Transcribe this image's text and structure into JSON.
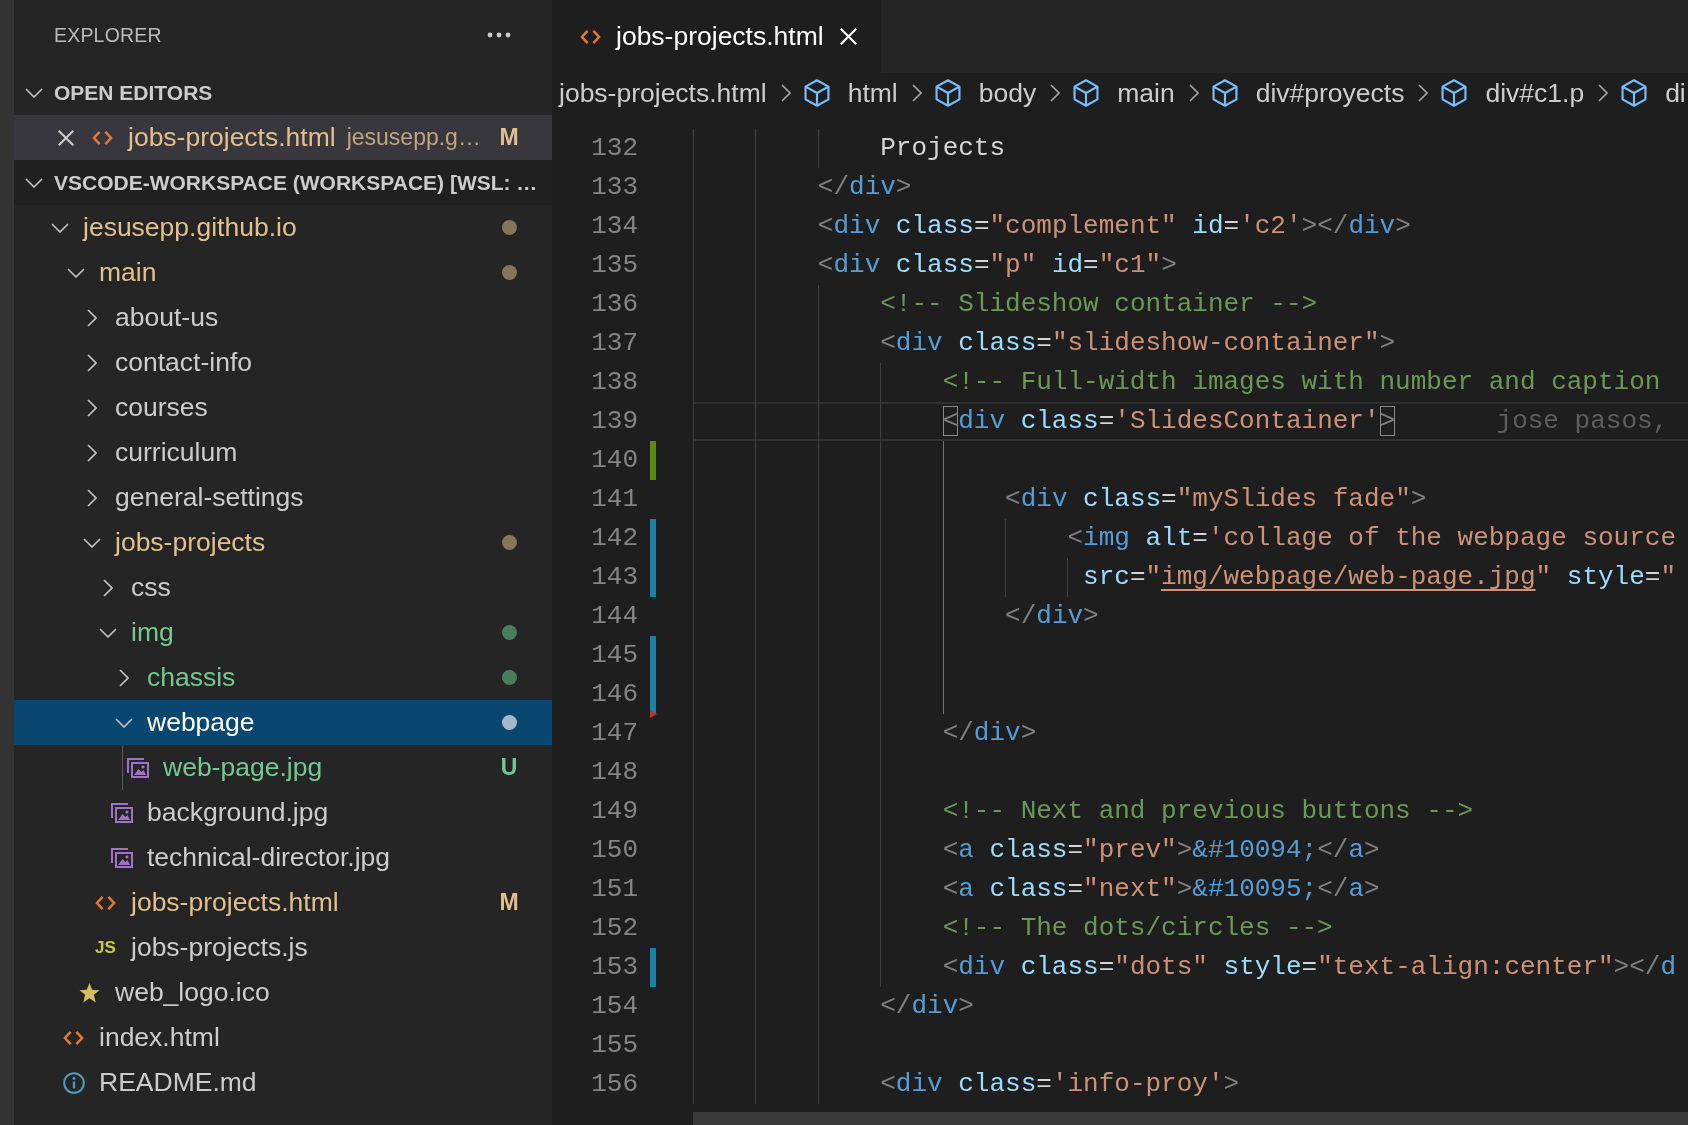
{
  "sidebar": {
    "title": "EXPLORER",
    "open_editors": {
      "title": "OPEN EDITORS",
      "expanded": true,
      "items": [
        {
          "name": "jobs-projects.html",
          "description": "jesusepp.g…",
          "kind": "html",
          "modified": true,
          "untracked": false,
          "badge": "M",
          "selected": true
        }
      ]
    },
    "workspace": {
      "title": "VSCODE-WORKSPACE (WORKSPACE) [WSL: …",
      "expanded": true,
      "tree": [
        {
          "name": "jesusepp.github.io",
          "kind": "folder",
          "modified": true,
          "untracked": false,
          "expanded": true,
          "selected": false,
          "children": [
            {
              "name": "main",
              "kind": "folder",
              "modified": true,
              "untracked": false,
              "expanded": true,
              "selected": false,
              "children": [
                {
                  "name": "about-us",
                  "kind": "folder",
                  "modified": false,
                  "untracked": false,
                  "expanded": false,
                  "selected": false
                },
                {
                  "name": "contact-info",
                  "kind": "folder",
                  "modified": false,
                  "untracked": false,
                  "expanded": false,
                  "selected": false
                },
                {
                  "name": "courses",
                  "kind": "folder",
                  "modified": false,
                  "untracked": false,
                  "expanded": false,
                  "selected": false
                },
                {
                  "name": "curriculum",
                  "kind": "folder",
                  "modified": false,
                  "untracked": false,
                  "expanded": false,
                  "selected": false
                },
                {
                  "name": "general-settings",
                  "kind": "folder",
                  "modified": false,
                  "untracked": false,
                  "expanded": false,
                  "selected": false
                },
                {
                  "name": "jobs-projects",
                  "kind": "folder",
                  "modified": true,
                  "untracked": false,
                  "expanded": true,
                  "selected": false,
                  "children": [
                    {
                      "name": "css",
                      "kind": "folder",
                      "modified": false,
                      "untracked": false,
                      "expanded": false,
                      "selected": false
                    },
                    {
                      "name": "img",
                      "kind": "folder",
                      "modified": false,
                      "untracked": true,
                      "expanded": true,
                      "selected": false,
                      "children": [
                        {
                          "name": "chassis",
                          "kind": "folder",
                          "modified": false,
                          "untracked": true,
                          "expanded": false,
                          "selected": false
                        },
                        {
                          "name": "webpage",
                          "kind": "folder",
                          "modified": false,
                          "untracked": true,
                          "expanded": true,
                          "selected": true,
                          "children": [
                            {
                              "name": "web-page.jpg",
                              "kind": "image",
                              "modified": false,
                              "untracked": true,
                              "badge": "U",
                              "selected": false
                            }
                          ]
                        },
                        {
                          "name": "background.jpg",
                          "kind": "image",
                          "modified": false,
                          "untracked": false,
                          "selected": false
                        },
                        {
                          "name": "technical-director.jpg",
                          "kind": "image",
                          "modified": false,
                          "untracked": false,
                          "selected": false
                        }
                      ]
                    },
                    {
                      "name": "jobs-projects.html",
                      "kind": "html",
                      "modified": true,
                      "untracked": false,
                      "badge": "M",
                      "selected": false
                    },
                    {
                      "name": "jobs-projects.js",
                      "kind": "script",
                      "modified": false,
                      "untracked": false,
                      "icon_text": "JS",
                      "selected": false
                    }
                  ]
                },
                {
                  "name": "web_logo.ico",
                  "kind": "favicon",
                  "modified": false,
                  "untracked": false,
                  "selected": false
                }
              ]
            },
            {
              "name": "index.html",
              "kind": "html",
              "modified": false,
              "untracked": false,
              "selected": false
            },
            {
              "name": "README.md",
              "kind": "info",
              "modified": false,
              "untracked": false,
              "selected": false
            }
          ]
        }
      ]
    }
  },
  "editor": {
    "tabs": [
      {
        "name": "jobs-projects.html",
        "kind": "html",
        "selected": true
      }
    ],
    "breadcrumbs": [
      {
        "label": "jobs-projects.html",
        "kind": "file"
      },
      {
        "label": "html",
        "kind": "element"
      },
      {
        "label": "body",
        "kind": "element"
      },
      {
        "label": "main",
        "kind": "element"
      },
      {
        "label": "div#proyects",
        "kind": "element"
      },
      {
        "label": "div#c1.p",
        "kind": "element"
      },
      {
        "label": "di",
        "kind": "element"
      }
    ],
    "lines": [
      {
        "number": "132",
        "current": false,
        "added": false,
        "modified": false,
        "deleted": false,
        "tokens": [
          {
            "kind": "text",
            "text": "            Projects"
          }
        ]
      },
      {
        "number": "133",
        "current": false,
        "added": false,
        "modified": false,
        "deleted": false,
        "tokens": [
          {
            "kind": "punct",
            "text": "        </"
          },
          {
            "kind": "tag",
            "text": "div"
          },
          {
            "kind": "punct",
            "text": ">"
          }
        ]
      },
      {
        "number": "134",
        "current": false,
        "added": false,
        "modified": false,
        "deleted": false,
        "tokens": [
          {
            "kind": "punct",
            "text": "        <"
          },
          {
            "kind": "tag",
            "text": "div"
          },
          {
            "kind": "attr",
            "text": " class"
          },
          {
            "kind": "op",
            "text": "="
          },
          {
            "kind": "string",
            "text": "\"complement\""
          },
          {
            "kind": "attr",
            "text": " id"
          },
          {
            "kind": "op",
            "text": "="
          },
          {
            "kind": "string",
            "text": "'c2'"
          },
          {
            "kind": "punct",
            "text": "></"
          },
          {
            "kind": "tag",
            "text": "div"
          },
          {
            "kind": "punct",
            "text": ">"
          }
        ]
      },
      {
        "number": "135",
        "current": false,
        "added": false,
        "modified": false,
        "deleted": false,
        "tokens": [
          {
            "kind": "punct",
            "text": "        <"
          },
          {
            "kind": "tag",
            "text": "div"
          },
          {
            "kind": "attr",
            "text": " class"
          },
          {
            "kind": "op",
            "text": "="
          },
          {
            "kind": "string",
            "text": "\"p\""
          },
          {
            "kind": "attr",
            "text": " id"
          },
          {
            "kind": "op",
            "text": "="
          },
          {
            "kind": "string",
            "text": "\"c1\""
          },
          {
            "kind": "punct",
            "text": ">"
          }
        ]
      },
      {
        "number": "136",
        "current": false,
        "added": false,
        "modified": false,
        "deleted": false,
        "tokens": [
          {
            "kind": "comment",
            "text": "            <!-- Slideshow container -->"
          }
        ]
      },
      {
        "number": "137",
        "current": false,
        "added": false,
        "modified": false,
        "deleted": false,
        "tokens": [
          {
            "kind": "punct",
            "text": "            <"
          },
          {
            "kind": "tag",
            "text": "div"
          },
          {
            "kind": "attr",
            "text": " class"
          },
          {
            "kind": "op",
            "text": "="
          },
          {
            "kind": "string",
            "text": "\"slideshow-container\""
          },
          {
            "kind": "punct",
            "text": ">"
          }
        ]
      },
      {
        "number": "138",
        "current": false,
        "added": false,
        "modified": false,
        "deleted": false,
        "tokens": [
          {
            "kind": "comment",
            "text": "                <!-- Full-width images with number and caption"
          }
        ]
      },
      {
        "number": "139",
        "current": true,
        "added": false,
        "modified": false,
        "deleted": false,
        "tokens": [
          {
            "kind": "bracket",
            "text": "                <"
          },
          {
            "kind": "tag",
            "text": "div"
          },
          {
            "kind": "attr",
            "text": " class"
          },
          {
            "kind": "op",
            "text": "="
          },
          {
            "kind": "string",
            "text": "'SlidesContainer'"
          },
          {
            "kind": "bracket",
            "text": ">"
          }
        ],
        "blame": "jose pasos,"
      },
      {
        "number": "140",
        "current": false,
        "added": true,
        "modified": false,
        "deleted": false
      },
      {
        "number": "141",
        "current": false,
        "added": false,
        "modified": false,
        "deleted": false,
        "tokens": [
          {
            "kind": "punct",
            "text": "                    <"
          },
          {
            "kind": "tag",
            "text": "div"
          },
          {
            "kind": "attr",
            "text": " class"
          },
          {
            "kind": "op",
            "text": "="
          },
          {
            "kind": "string",
            "text": "\"mySlides fade\""
          },
          {
            "kind": "punct",
            "text": ">"
          }
        ]
      },
      {
        "number": "142",
        "current": false,
        "added": false,
        "modified": true,
        "deleted": false,
        "tokens": [
          {
            "kind": "punct",
            "text": "                        <"
          },
          {
            "kind": "tag",
            "text": "img"
          },
          {
            "kind": "attr",
            "text": " alt"
          },
          {
            "kind": "op",
            "text": "="
          },
          {
            "kind": "string",
            "text": "'collage of the webpage source"
          }
        ]
      },
      {
        "number": "143",
        "current": false,
        "added": false,
        "modified": true,
        "deleted": false,
        "tokens": [
          {
            "kind": "attr",
            "text": "                         src"
          },
          {
            "kind": "op",
            "text": "="
          },
          {
            "kind": "string",
            "text": "\""
          },
          {
            "kind": "link",
            "text": "img/webpage/web-page.jpg"
          },
          {
            "kind": "string",
            "text": "\""
          },
          {
            "kind": "attr",
            "text": " style"
          },
          {
            "kind": "op",
            "text": "="
          },
          {
            "kind": "string",
            "text": "\""
          }
        ]
      },
      {
        "number": "144",
        "current": false,
        "added": false,
        "modified": false,
        "deleted": false,
        "tokens": [
          {
            "kind": "punct",
            "text": "                    </"
          },
          {
            "kind": "tag",
            "text": "div"
          },
          {
            "kind": "punct",
            "text": ">"
          }
        ]
      },
      {
        "number": "145",
        "current": false,
        "added": false,
        "modified": true,
        "deleted": false
      },
      {
        "number": "146",
        "current": false,
        "added": false,
        "modified": true,
        "deleted": false
      },
      {
        "number": "147",
        "current": false,
        "added": false,
        "modified": false,
        "deleted": true,
        "tokens": [
          {
            "kind": "punct",
            "text": "                </"
          },
          {
            "kind": "tag",
            "text": "div"
          },
          {
            "kind": "punct",
            "text": ">"
          }
        ]
      },
      {
        "number": "148",
        "current": false,
        "added": false,
        "modified": false,
        "deleted": false
      },
      {
        "number": "149",
        "current": false,
        "added": false,
        "modified": false,
        "deleted": false,
        "tokens": [
          {
            "kind": "comment",
            "text": "                <!-- Next and previous buttons -->"
          }
        ]
      },
      {
        "number": "150",
        "current": false,
        "added": false,
        "modified": false,
        "deleted": false,
        "tokens": [
          {
            "kind": "punct",
            "text": "                <"
          },
          {
            "kind": "tag",
            "text": "a"
          },
          {
            "kind": "attr",
            "text": " class"
          },
          {
            "kind": "op",
            "text": "="
          },
          {
            "kind": "string",
            "text": "\"prev\""
          },
          {
            "kind": "punct",
            "text": ">"
          },
          {
            "kind": "entity",
            "text": "&#10094;"
          },
          {
            "kind": "punct",
            "text": "</"
          },
          {
            "kind": "tag",
            "text": "a"
          },
          {
            "kind": "punct",
            "text": ">"
          }
        ]
      },
      {
        "number": "151",
        "current": false,
        "added": false,
        "modified": false,
        "deleted": false,
        "tokens": [
          {
            "kind": "punct",
            "text": "                <"
          },
          {
            "kind": "tag",
            "text": "a"
          },
          {
            "kind": "attr",
            "text": " class"
          },
          {
            "kind": "op",
            "text": "="
          },
          {
            "kind": "string",
            "text": "\"next\""
          },
          {
            "kind": "punct",
            "text": ">"
          },
          {
            "kind": "entity",
            "text": "&#10095;"
          },
          {
            "kind": "punct",
            "text": "</"
          },
          {
            "kind": "tag",
            "text": "a"
          },
          {
            "kind": "punct",
            "text": ">"
          }
        ]
      },
      {
        "number": "152",
        "current": false,
        "added": false,
        "modified": false,
        "deleted": false,
        "tokens": [
          {
            "kind": "comment",
            "text": "                <!-- The dots/circles -->"
          }
        ]
      },
      {
        "number": "153",
        "current": false,
        "added": false,
        "modified": true,
        "deleted": false,
        "tokens": [
          {
            "kind": "punct",
            "text": "                <"
          },
          {
            "kind": "tag",
            "text": "div"
          },
          {
            "kind": "attr",
            "text": " class"
          },
          {
            "kind": "op",
            "text": "="
          },
          {
            "kind": "string",
            "text": "\"dots\""
          },
          {
            "kind": "attr",
            "text": " style"
          },
          {
            "kind": "op",
            "text": "="
          },
          {
            "kind": "string",
            "text": "\"text-align:center\""
          },
          {
            "kind": "punct",
            "text": "></"
          },
          {
            "kind": "tag",
            "text": "d"
          }
        ]
      },
      {
        "number": "154",
        "current": false,
        "added": false,
        "modified": false,
        "deleted": false,
        "tokens": [
          {
            "kind": "punct",
            "text": "            </"
          },
          {
            "kind": "tag",
            "text": "div"
          },
          {
            "kind": "punct",
            "text": ">"
          }
        ]
      },
      {
        "number": "155",
        "current": false,
        "added": false,
        "modified": false,
        "deleted": false
      },
      {
        "number": "156",
        "current": false,
        "added": false,
        "modified": false,
        "deleted": false,
        "tokens": [
          {
            "kind": "punct",
            "text": "            <"
          },
          {
            "kind": "tag",
            "text": "div"
          },
          {
            "kind": "attr",
            "text": " class"
          },
          {
            "kind": "op",
            "text": "="
          },
          {
            "kind": "string",
            "text": "'info-proy'"
          },
          {
            "kind": "punct",
            "text": ">"
          }
        ]
      }
    ]
  }
}
